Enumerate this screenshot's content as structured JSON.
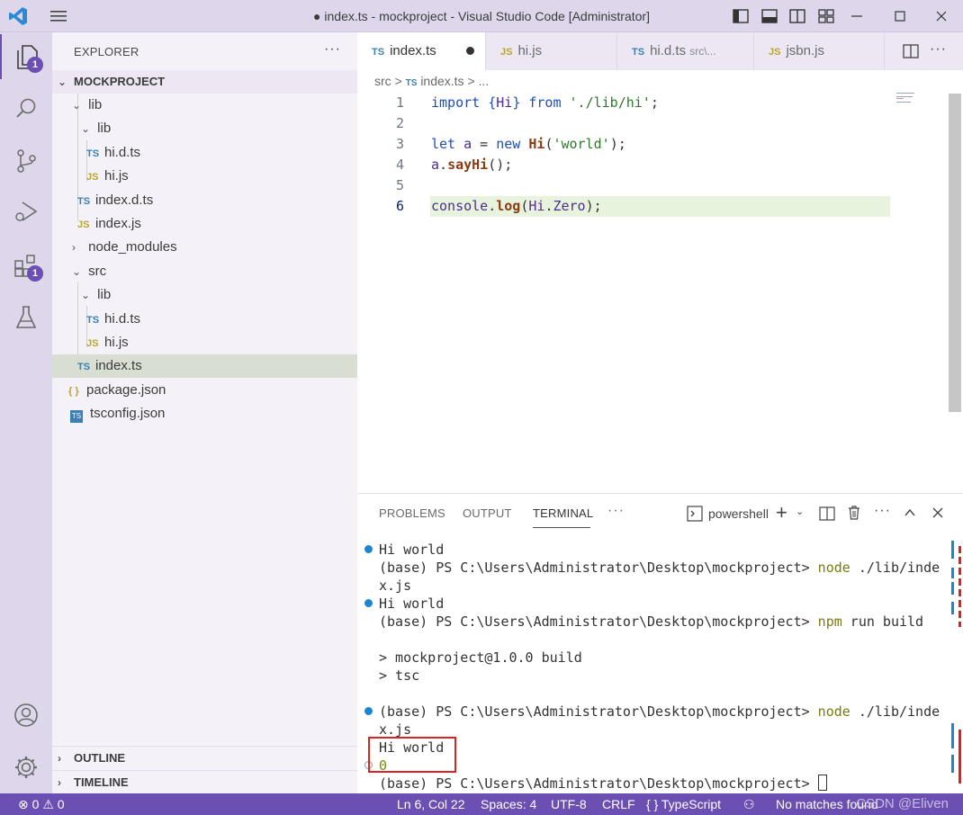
{
  "window": {
    "title": "● index.ts - mockproject - Visual Studio Code [Administrator]"
  },
  "activity_bar": {
    "explorer_badge": "1",
    "extensions_badge": "1"
  },
  "explorer": {
    "header": "EXPLORER",
    "more": "···",
    "project_title": "MOCKPROJECT",
    "rows": [
      {
        "label": "lib",
        "icon": "",
        "chevron": "⌄"
      },
      {
        "label": "lib",
        "icon": "",
        "chevron": "⌄"
      },
      {
        "label": "hi.d.ts",
        "icon": "TS"
      },
      {
        "label": "hi.js",
        "icon": "JS"
      },
      {
        "label": "index.d.ts",
        "icon": "TS"
      },
      {
        "label": "index.js",
        "icon": "JS"
      },
      {
        "label": "node_modules",
        "icon": "",
        "chevron": "›"
      },
      {
        "label": "src",
        "icon": "",
        "chevron": "⌄"
      },
      {
        "label": "lib",
        "icon": "",
        "chevron": "⌄"
      },
      {
        "label": "hi.d.ts",
        "icon": "TS"
      },
      {
        "label": "hi.js",
        "icon": "JS"
      },
      {
        "label": "index.ts",
        "icon": "TS"
      },
      {
        "label": "package.json",
        "icon": "{ }"
      },
      {
        "label": "tsconfig.json",
        "icon": "TS"
      }
    ],
    "outline_label": "OUTLINE",
    "timeline_label": "TIMELINE"
  },
  "tabs": [
    {
      "icon": "TS",
      "label": "index.ts",
      "active": true
    },
    {
      "icon": "JS",
      "label": "hi.js"
    },
    {
      "icon": "TS",
      "label": "hi.d.ts",
      "description": "src\\..."
    },
    {
      "icon": "JS",
      "label": "jsbn.js"
    }
  ],
  "breadcrumb": {
    "folder": "src",
    "sep": ">",
    "file_icon": "TS",
    "file": "index.ts",
    "trail": "> ..."
  },
  "editor": {
    "line_numbers": [
      "1",
      "2",
      "3",
      "4",
      "5",
      "6"
    ],
    "lines": [
      [
        {
          "t": "import",
          "c": "kw"
        },
        {
          "t": " "
        },
        {
          "t": "{",
          "c": "kw"
        },
        {
          "t": "Hi",
          "c": "var"
        },
        {
          "t": "}",
          "c": "kw"
        },
        {
          "t": " "
        },
        {
          "t": "from",
          "c": "kw"
        },
        {
          "t": " "
        },
        {
          "t": "'./lib/hi'",
          "c": "str"
        },
        {
          "t": ";"
        }
      ],
      [],
      [
        {
          "t": "let",
          "c": "kw"
        },
        {
          "t": " "
        },
        {
          "t": "a",
          "c": "var"
        },
        {
          "t": " = "
        },
        {
          "t": "new",
          "c": "kw"
        },
        {
          "t": " "
        },
        {
          "t": "Hi",
          "c": "fn"
        },
        {
          "t": "("
        },
        {
          "t": "'world'",
          "c": "str"
        },
        {
          "t": ");"
        }
      ],
      [
        {
          "t": "a",
          "c": "var"
        },
        {
          "t": "."
        },
        {
          "t": "sayHi",
          "c": "fn"
        },
        {
          "t": "();"
        }
      ],
      [],
      [
        {
          "t": "console",
          "c": "var"
        },
        {
          "t": "."
        },
        {
          "t": "log",
          "c": "fn"
        },
        {
          "t": "("
        },
        {
          "t": "Hi",
          "c": "cls"
        },
        {
          "t": "."
        },
        {
          "t": "Zero",
          "c": "var"
        },
        {
          "t": ");"
        }
      ]
    ]
  },
  "panel": {
    "tabs": [
      "PROBLEMS",
      "OUTPUT",
      "TERMINAL"
    ],
    "more": "···",
    "shell": "powershell",
    "terminal": [
      {
        "text": "Hi world",
        "dot": "blue"
      },
      {
        "text": "(base) PS C:\\Users\\Administrator\\Desktop\\mockproject> ",
        "cmd": "node",
        "rest": " ./lib/inde"
      },
      {
        "text": "x.js"
      },
      {
        "text": "Hi world",
        "dot": "blue"
      },
      {
        "text": "(base) PS C:\\Users\\Administrator\\Desktop\\mockproject> ",
        "cmd": "npm",
        "rest": " run build"
      },
      {
        "text": ""
      },
      {
        "text": "> mockproject@1.0.0 build"
      },
      {
        "text": "> tsc"
      },
      {
        "text": ""
      },
      {
        "text": "(base) PS C:\\Users\\Administrator\\Desktop\\mockproject> ",
        "cmd": "node",
        "rest": " ./lib/inde",
        "dot": "blue"
      },
      {
        "text": "x.js"
      },
      {
        "text": "Hi world"
      },
      {
        "text": "0",
        "dot": "hollow"
      },
      {
        "text": "(base) PS C:\\Users\\Administrator\\Desktop\\mockproject> ",
        "cursor": true
      }
    ]
  },
  "status_bar": {
    "errors": "0",
    "warnings": "0",
    "position": "Ln 6, Col 22",
    "spaces": "Spaces: 4",
    "encoding": "UTF-8",
    "eol": "CRLF",
    "lang_braces": "{ }",
    "language": "TypeScript",
    "matches": "No matches found",
    "watermark": "CSDN @Eliven"
  },
  "colors": {
    "accent": "#6b4fb3",
    "title_bg": "#ded6ea",
    "current_line": "#e7f3dc",
    "highlight_box": "#dd2222"
  }
}
